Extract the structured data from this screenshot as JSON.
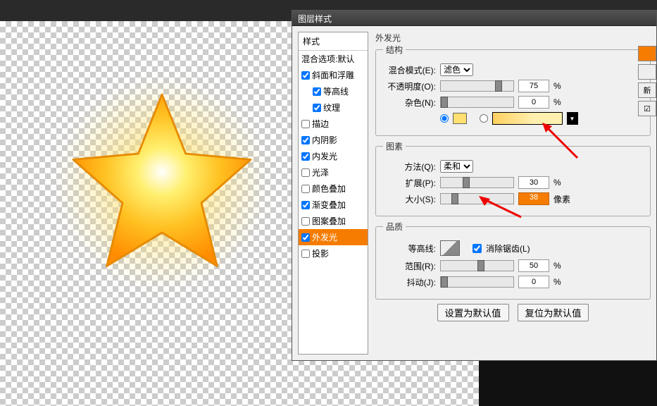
{
  "dialog": {
    "title": "图层样式"
  },
  "styles_panel": {
    "header": "样式",
    "blend_defaults": "混合选项:默认",
    "items": [
      {
        "label": "斜面和浮雕",
        "checked": true,
        "indent": false
      },
      {
        "label": "等高线",
        "checked": true,
        "indent": true
      },
      {
        "label": "纹理",
        "checked": true,
        "indent": true
      },
      {
        "label": "描边",
        "checked": false,
        "indent": false
      },
      {
        "label": "内阴影",
        "checked": true,
        "indent": false
      },
      {
        "label": "内发光",
        "checked": true,
        "indent": false
      },
      {
        "label": "光泽",
        "checked": false,
        "indent": false
      },
      {
        "label": "颜色叠加",
        "checked": false,
        "indent": false
      },
      {
        "label": "渐变叠加",
        "checked": true,
        "indent": false
      },
      {
        "label": "图案叠加",
        "checked": false,
        "indent": false
      },
      {
        "label": "外发光",
        "checked": true,
        "indent": false,
        "selected": true
      },
      {
        "label": "投影",
        "checked": false,
        "indent": false
      }
    ]
  },
  "outer_glow": {
    "section_title": "外发光",
    "structure": {
      "legend": "结构",
      "blend_mode_label": "混合模式(E):",
      "blend_mode_value": "滤色",
      "opacity_label": "不透明度(O):",
      "opacity_value": "75",
      "opacity_unit": "%",
      "noise_label": "杂色(N):",
      "noise_value": "0",
      "noise_unit": "%"
    },
    "elements": {
      "legend": "图素",
      "technique_label": "方法(Q):",
      "technique_value": "柔和",
      "spread_label": "扩展(P):",
      "spread_value": "30",
      "spread_unit": "%",
      "size_label": "大小(S):",
      "size_value": "38",
      "size_unit": "像素"
    },
    "quality": {
      "legend": "品质",
      "contour_label": "等高线:",
      "antialias_label": "消除锯齿(L)",
      "antialias_checked": true,
      "range_label": "范围(R):",
      "range_value": "50",
      "range_unit": "%",
      "jitter_label": "抖动(J):",
      "jitter_value": "0",
      "jitter_unit": "%"
    },
    "buttons": {
      "make_default": "设置为默认值",
      "reset_default": "复位为默认值"
    }
  },
  "right_buttons": {
    "new": "新"
  }
}
